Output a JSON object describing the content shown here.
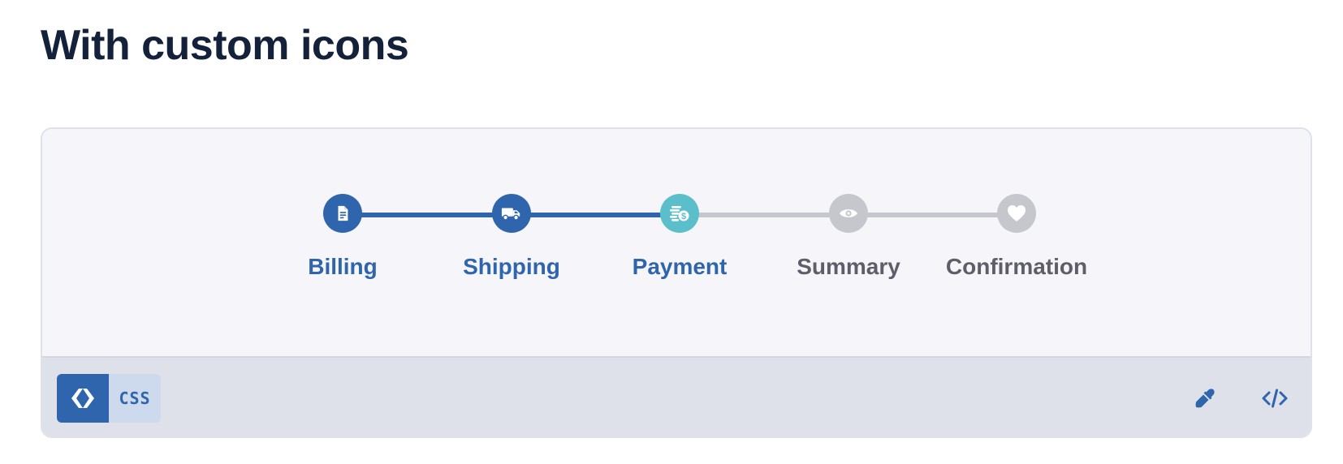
{
  "page": {
    "title": "With custom icons"
  },
  "stepper": {
    "steps": [
      {
        "label": "Billing",
        "state": "done",
        "icon": "document-icon"
      },
      {
        "label": "Shipping",
        "state": "done",
        "icon": "truck-icon"
      },
      {
        "label": "Payment",
        "state": "active",
        "icon": "coins-dollar-icon"
      },
      {
        "label": "Summary",
        "state": "pending",
        "icon": "eye-icon"
      },
      {
        "label": "Confirmation",
        "state": "pending",
        "icon": "heart-icon"
      }
    ]
  },
  "toolbar": {
    "css_label": "CSS",
    "icons": [
      "code-brackets-icon",
      "eyedropper-icon",
      "code-icon"
    ]
  },
  "colors": {
    "done": "#2f65ac",
    "active": "#5bbfcb",
    "pending": "#c6c7cc",
    "title": "#14213a"
  }
}
